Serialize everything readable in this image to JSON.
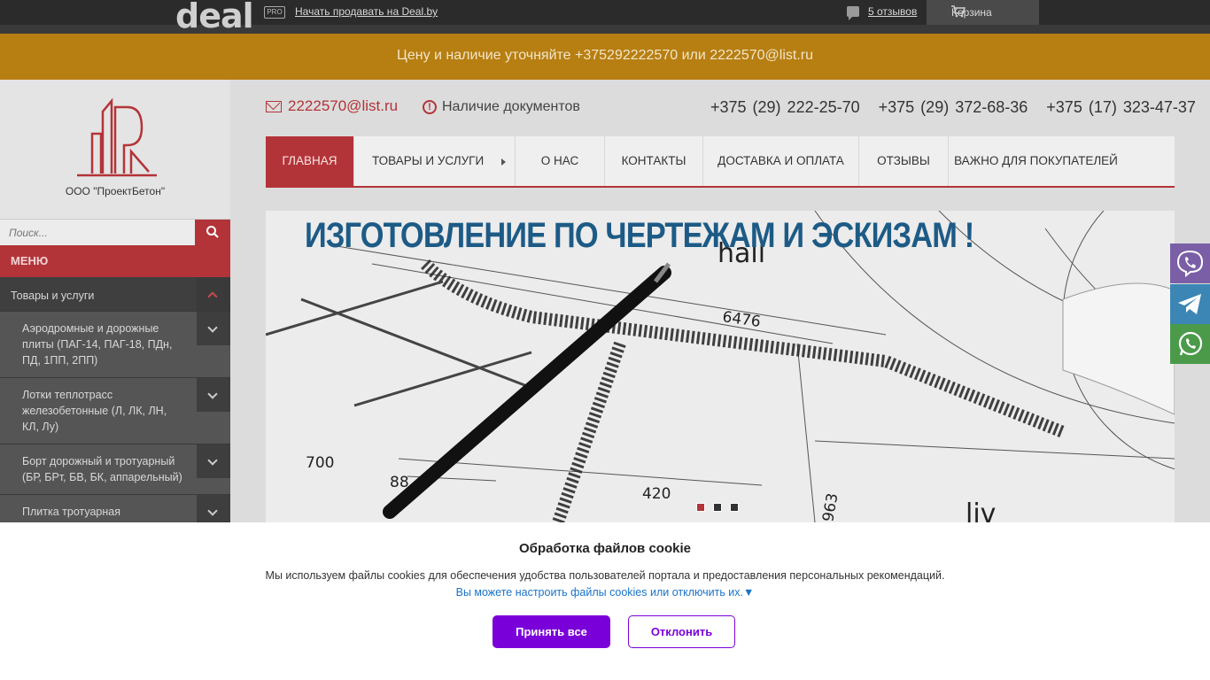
{
  "topbar": {
    "logo": "deal",
    "pro_badge": "PRO",
    "sell_link": "Начать продавать на Deal.by",
    "reviews_link": "5 отзывов",
    "cart_label": "Корзина"
  },
  "banner": {
    "text": "Цену и наличие уточняйте +375292222570 или 2222570@list.ru"
  },
  "company": {
    "name": "ООО \"ПроектБетон\""
  },
  "search": {
    "placeholder": "Поиск..."
  },
  "menu": {
    "header": "МЕНЮ",
    "top_item": "Товары и услуги",
    "items": [
      "Аэродромные и дорожные плиты (ПАГ-14, ПАГ-18, ПДн, ПД, 1ПП, 2ПП)",
      "Лотки теплотрасс железобетонные (Л, ЛК, ЛН, КЛ, Лу)",
      "Борт дорожный и тротуарный (БР, БРт, БВ, БК, аппарельный)",
      "Плитка тротуарная"
    ]
  },
  "contacts": {
    "email": "2222570@list.ru",
    "docs": "Наличие документов",
    "phones": [
      "+375 (29) 222-25-70",
      "+375 (29) 372-68-36",
      "+375 (17) 323-47-37"
    ]
  },
  "nav": {
    "items": [
      "ГЛАВНАЯ",
      "ТОВАРЫ И УСЛУГИ",
      "О НАС",
      "КОНТАКТЫ",
      "ДОСТАВКА И ОПЛАТА",
      "ОТЗЫВЫ",
      "ВАЖНО ДЛЯ ПОКУПАТЕЛЕЙ"
    ]
  },
  "slider": {
    "title": "ИЗГОТОВЛЕНИЕ ПО ЧЕРТЕЖАМ И ЭСКИЗАМ !",
    "drawing_labels": [
      "hall",
      "6476",
      "700",
      "88",
      "420",
      "963",
      "liv"
    ]
  },
  "cookie": {
    "title": "Обработка файлов cookie",
    "text": "Мы используем файлы cookies для обеспечения удобства пользователей портала и предоставления персональных рекомендаций.",
    "link": "Вы можете настроить файлы cookies или отключить их.▼",
    "accept": "Принять все",
    "decline": "Отклонить"
  },
  "colors": {
    "accent_red": "#b33438",
    "banner_orange": "#b77e12",
    "cookie_purple": "#7a00d9",
    "title_blue": "#1d5b86"
  }
}
